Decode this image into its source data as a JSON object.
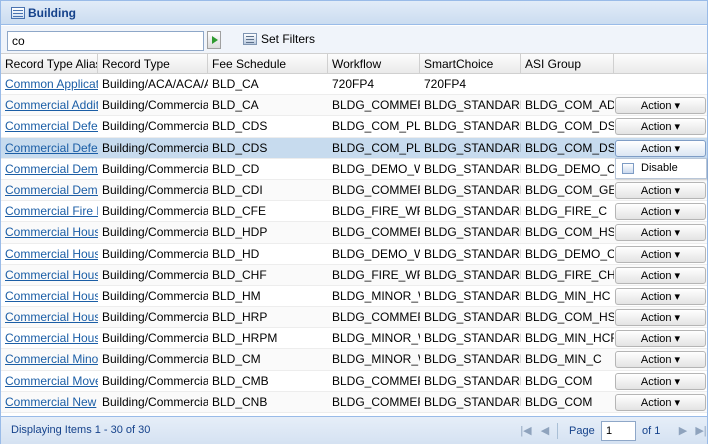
{
  "title": "Building",
  "toolbar": {
    "search_value": "co",
    "set_filters_label": "Set Filters"
  },
  "columns": [
    "Record Type Alias",
    "Record Type",
    "Fee Schedule",
    "Workflow",
    "SmartChoice",
    "ASI Group",
    ""
  ],
  "action_label": "Action ▾",
  "rows": [
    {
      "alias": "Common Applicat",
      "record_type": "Building/ACA/ACA/A",
      "fee": "BLD_CA",
      "workflow": "720FP4",
      "smart": "720FP4",
      "asi": "",
      "has_action": false
    },
    {
      "alias": "Commercial Additi",
      "record_type": "Building/Commercial",
      "fee": "BLD_CA",
      "workflow": "BLDG_COMMER",
      "smart": "BLDG_STANDARI",
      "asi": "BLDG_COM_AD",
      "has_action": true
    },
    {
      "alias": "Commercial Defer",
      "record_type": "Building/Commercial",
      "fee": "BLD_CDS",
      "workflow": "BLDG_COM_PL",
      "smart": "BLDG_STANDARI",
      "asi": "BLDG_COM_DS",
      "has_action": true
    },
    {
      "alias": "Commercial Defer",
      "record_type": "Building/Commercial",
      "fee": "BLD_CDS",
      "workflow": "BLDG_COM_PL",
      "smart": "BLDG_STANDARI",
      "asi": "BLDG_COM_DS",
      "has_action": true,
      "selected": true
    },
    {
      "alias": "Commercial Demo",
      "record_type": "Building/Commercial",
      "fee": "BLD_CD",
      "workflow": "BLDG_DEMO_W",
      "smart": "BLDG_STANDARI",
      "asi": "BLDG_DEMO_C",
      "has_action": false
    },
    {
      "alias": "Commercial Demo",
      "record_type": "Building/Commercial",
      "fee": "BLD_CDI",
      "workflow": "BLDG_COMMER",
      "smart": "BLDG_STANDARI",
      "asi": "BLDG_COM_GE",
      "has_action": true
    },
    {
      "alias": "Commercial Fire E",
      "record_type": "Building/Commercial",
      "fee": "BLD_CFE",
      "workflow": "BLDG_FIRE_WF",
      "smart": "BLDG_STANDARI",
      "asi": "BLDG_FIRE_C",
      "has_action": true
    },
    {
      "alias": "Commercial Housi",
      "record_type": "Building/Commercial",
      "fee": "BLD_HDP",
      "workflow": "BLDG_COMMER",
      "smart": "BLDG_STANDARI",
      "asi": "BLDG_COM_HS",
      "has_action": true
    },
    {
      "alias": "Commercial Housi",
      "record_type": "Building/Commercial",
      "fee": "BLD_HD",
      "workflow": "BLDG_DEMO_W",
      "smart": "BLDG_STANDARI",
      "asi": "BLDG_DEMO_C",
      "has_action": true
    },
    {
      "alias": "Commercial Housi",
      "record_type": "Building/Commercial",
      "fee": "BLD_CHF",
      "workflow": "BLDG_FIRE_WF",
      "smart": "BLDG_STANDARI",
      "asi": "BLDG_FIRE_CH",
      "has_action": true
    },
    {
      "alias": "Commercial Housi",
      "record_type": "Building/Commercial",
      "fee": "BLD_HM",
      "workflow": "BLDG_MINOR_W",
      "smart": "BLDG_STANDARI",
      "asi": "BLDG_MIN_HC",
      "has_action": true
    },
    {
      "alias": "Commercial Housi",
      "record_type": "Building/Commercial",
      "fee": "BLD_HRP",
      "workflow": "BLDG_COMMER",
      "smart": "BLDG_STANDARI",
      "asi": "BLDG_COM_HS",
      "has_action": true
    },
    {
      "alias": "Commercial Housi",
      "record_type": "Building/Commercial",
      "fee": "BLD_HRPM",
      "workflow": "BLDG_MINOR_W",
      "smart": "BLDG_STANDARI",
      "asi": "BLDG_MIN_HCF",
      "has_action": true
    },
    {
      "alias": "Commercial Minor",
      "record_type": "Building/Commercial",
      "fee": "BLD_CM",
      "workflow": "BLDG_MINOR_W",
      "smart": "BLDG_STANDARI",
      "asi": "BLDG_MIN_C",
      "has_action": true
    },
    {
      "alias": "Commercial Move",
      "record_type": "Building/Commercial",
      "fee": "BLD_CMB",
      "workflow": "BLDG_COMMER",
      "smart": "BLDG_STANDARI",
      "asi": "BLDG_COM",
      "has_action": true
    },
    {
      "alias": "Commercial New",
      "record_type": "Building/Commercial",
      "fee": "BLD_CNB",
      "workflow": "BLDG_COMMER",
      "smart": "BLDG_STANDARI",
      "asi": "BLDG_COM",
      "has_action": true
    }
  ],
  "menu": {
    "disable_label": "Disable"
  },
  "footer": {
    "display_text": "Displaying Items 1 - 30 of 30",
    "page_label": "Page",
    "page_value": "1",
    "of_label": "of 1"
  }
}
